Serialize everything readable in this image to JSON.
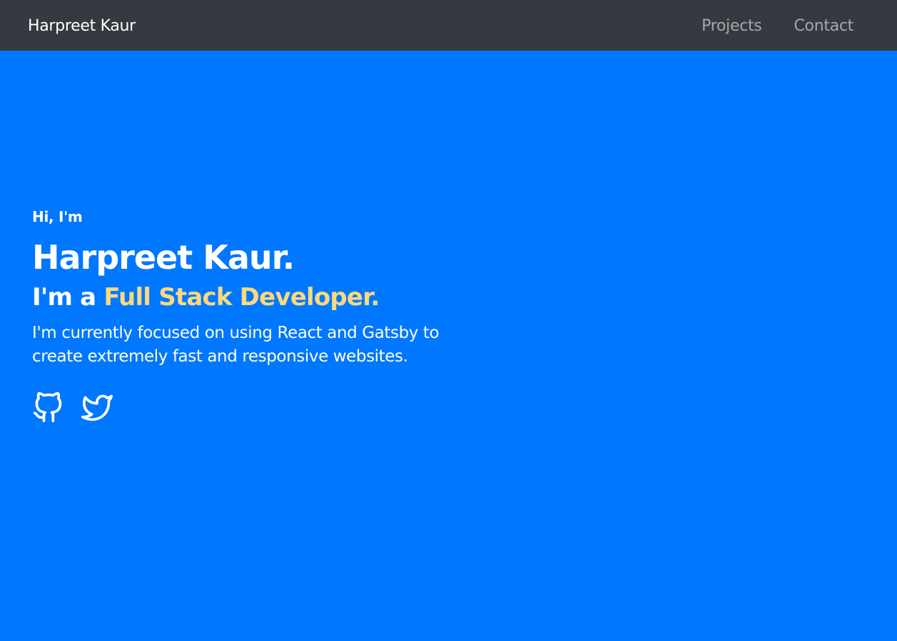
{
  "navbar": {
    "brand": "Harpreet Kaur",
    "links": [
      {
        "label": "Projects"
      },
      {
        "label": "Contact"
      }
    ],
    "background": "#343a40"
  },
  "hero": {
    "greeting": "Hi, I'm",
    "name": "Harpreet Kaur.",
    "role_prefix": "I'm a ",
    "role_highlight": "Full Stack Developer.",
    "description": "I'm currently focused on using React and Gatsby to create extremely fast and responsive websites.",
    "background": "#0077ff",
    "highlight_color": "#ffd97a",
    "social": [
      {
        "icon": "github-icon"
      },
      {
        "icon": "twitter-icon"
      }
    ]
  }
}
